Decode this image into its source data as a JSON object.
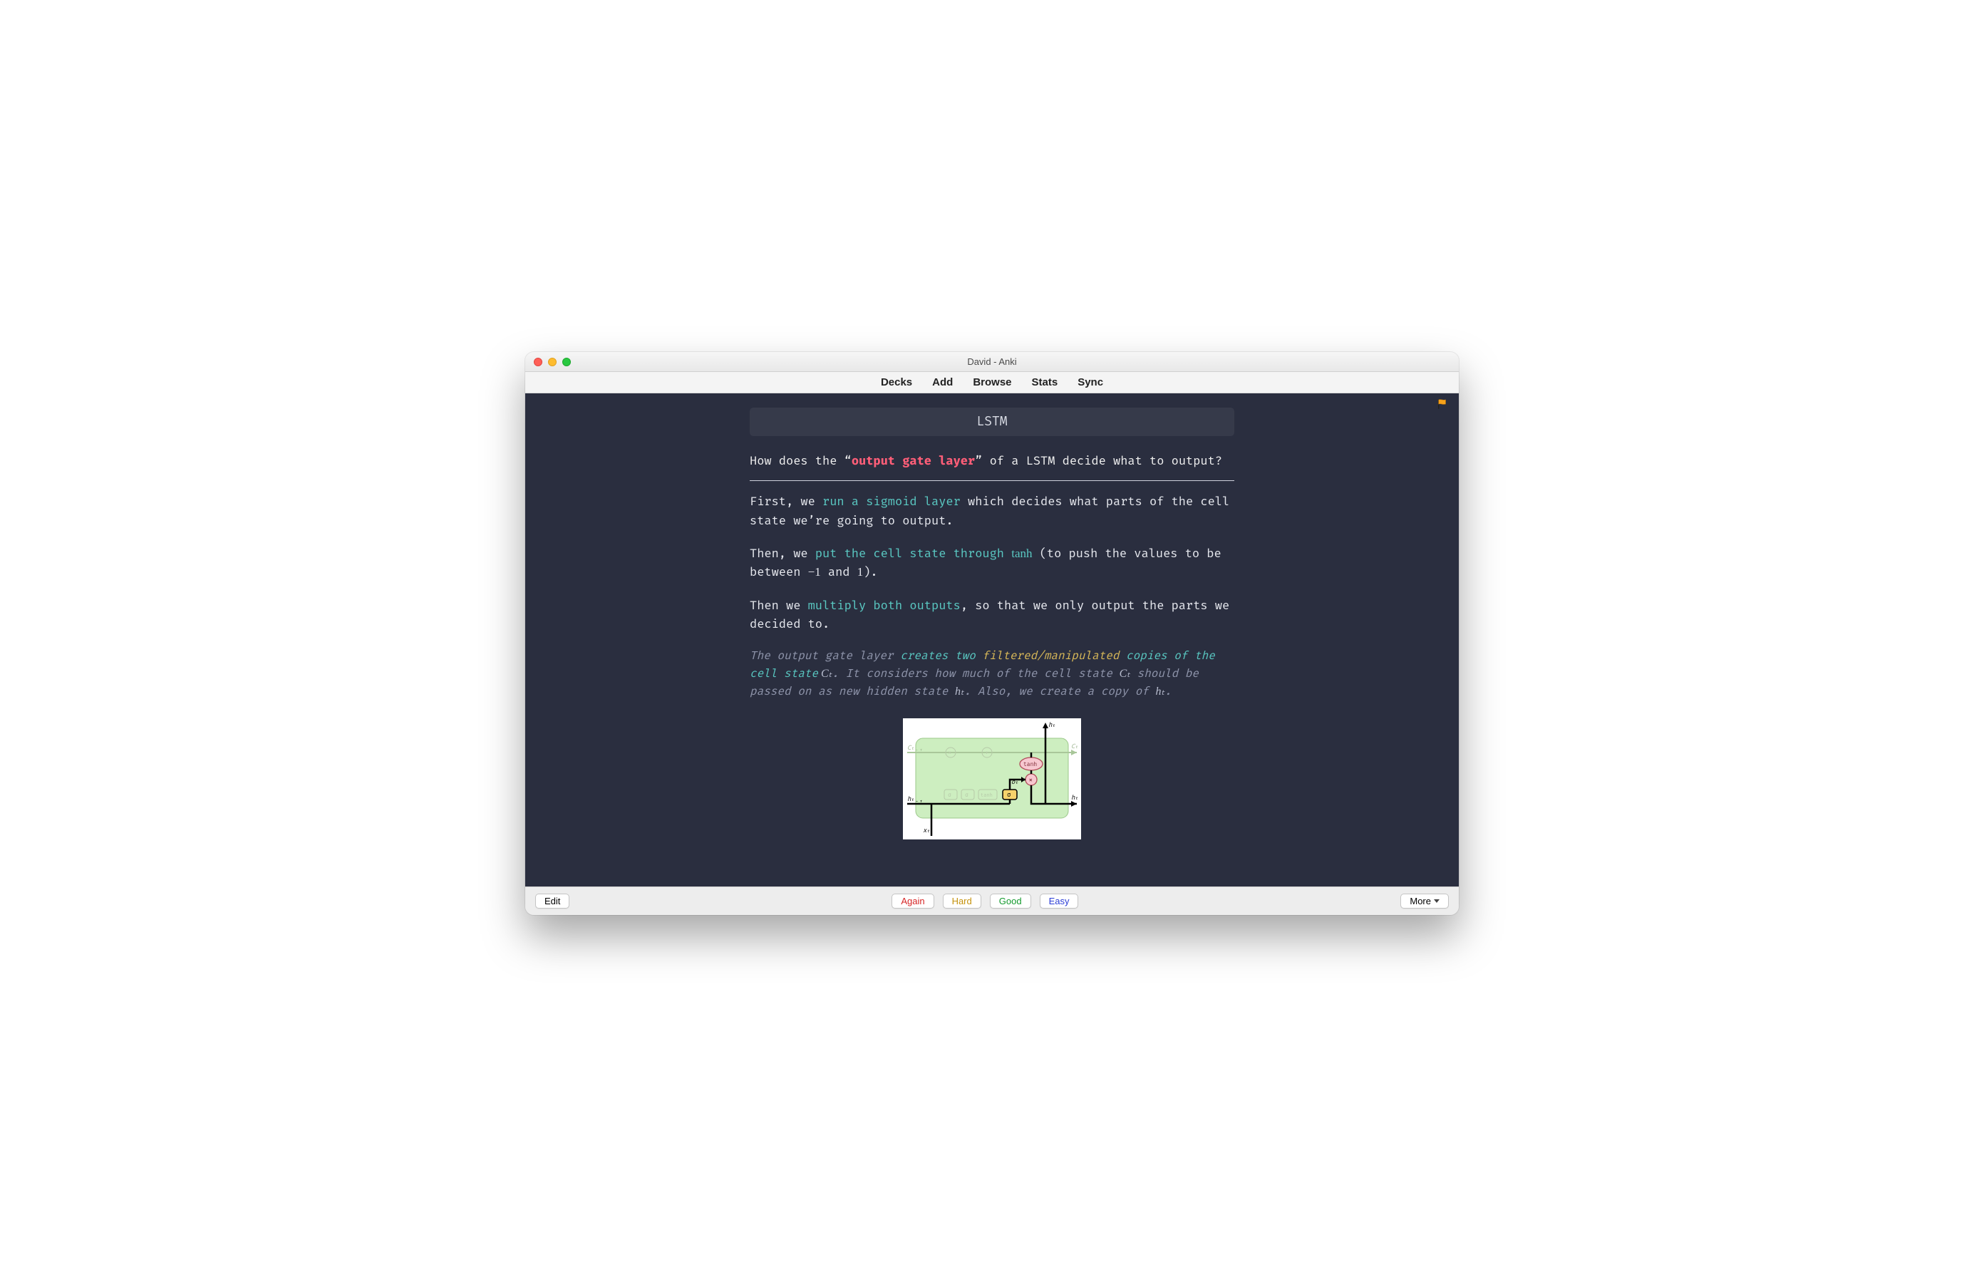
{
  "window": {
    "title": "David - Anki"
  },
  "menubar": {
    "items": [
      "Decks",
      "Add",
      "Browse",
      "Stats",
      "Sync"
    ]
  },
  "card": {
    "deck_label": "LSTM",
    "question_prefix": "How does the “",
    "question_highlight": "output gate layer",
    "question_suffix": "” of a LSTM decide what to output?",
    "answer": {
      "p1_a": "First, we ",
      "p1_h": "run a sigmoid layer",
      "p1_b": " which decides what parts of the cell state we’re going to output.",
      "p2_a": "Then, we ",
      "p2_h": "put the cell state through ",
      "p2_tanh": "tanh",
      "p2_b": " (to push the values to be between ",
      "p2_neg1": "−1",
      "p2_and": " and ",
      "p2_one": "1",
      "p2_c": ").",
      "p3_a": "Then we ",
      "p3_h": "multiply both outputs",
      "p3_b": ", so that we only output the parts we decided to."
    },
    "note": {
      "n1": "The output gate layer ",
      "n2": "creates two",
      "n3": " ",
      "n4": "filtered/manipulated",
      "n5": " ",
      "n6": "copies of the cell state",
      "ct": " Cₜ",
      "n7": ". It considers how much of the cell state ",
      "ct2": "Cₜ",
      "n8": " should be passed on as new hidden state ",
      "ht": "hₜ",
      "n9": ". Also, we create a copy of ",
      "ht2": "hₜ",
      "n10": "."
    },
    "diagram_labels": {
      "ht_top": "hₜ",
      "Ct_right": "Cₜ",
      "Ct_prev": "Cₜ₋₁",
      "ht_prev": "hₜ₋₁",
      "ht_right": "hₜ",
      "xt": "xₜ",
      "ot": "oₜ",
      "tanh": "tanh",
      "sigma": "σ"
    }
  },
  "bottombar": {
    "edit": "Edit",
    "again": "Again",
    "hard": "Hard",
    "good": "Good",
    "easy": "Easy",
    "more": "More"
  },
  "icons": {
    "flag": "flag-icon"
  }
}
